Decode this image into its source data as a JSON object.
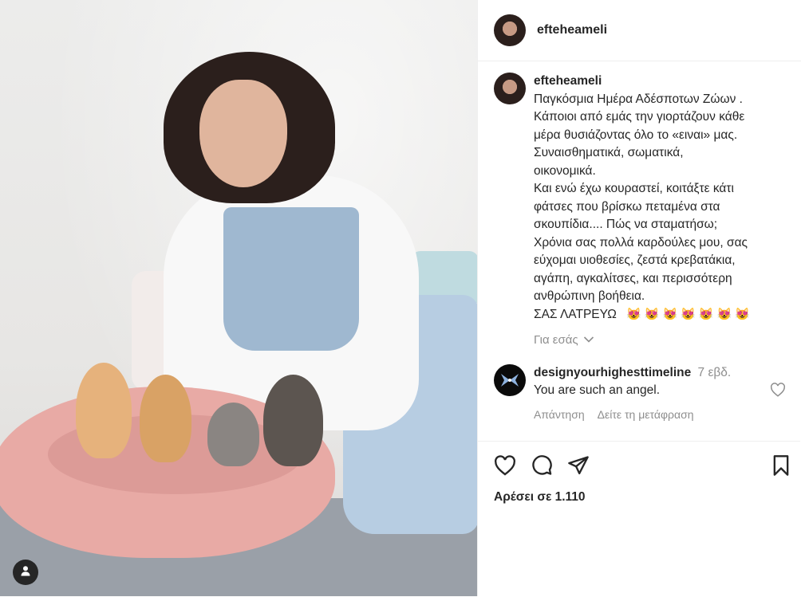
{
  "post": {
    "username": "efteheameli",
    "caption_lines": [
      "Παγκόσμια Ημέρα Αδέσποτων Ζώων .",
      "Κάποιοι από εμάς την γιορτάζουν κάθε",
      "μέρα θυσιάζοντας όλο το «ειναι» μας.",
      "Συναισθηματικά, σωματικά,",
      "οικονομικά.",
      "Και ενώ έχω κουραστεί, κοιτάξτε κάτι",
      "φάτσες που βρίσκω πεταμένα στα",
      "σκουπίδια.... Πώς να σταματήσω;",
      "Χρόνια σας πολλά καρδούλες μου, σας",
      "εύχομαι υιοθεσίες, ζεστά κρεβατάκια,",
      "αγάπη, αγκαλίτσες, και περισσότερη",
      "ανθρώπινη βοήθεια.",
      "ΣΑΣ ΛΑΤΡΕΥΩ"
    ],
    "emoji_count": 7,
    "see_translation": "Για εσάς",
    "likes_text": "Αρέσει σε 1.110"
  },
  "comments": [
    {
      "username": "designyourhighesttimeline",
      "time": "7 εβδ.",
      "text": "You are such an angel.",
      "reply_label": "Απάντηση",
      "translate_label": "Δείτε τη μετάφραση"
    }
  ],
  "icons": {
    "like": "heart-icon",
    "comment": "comment-icon",
    "share": "send-icon",
    "save": "bookmark-icon",
    "tagged": "person-icon"
  },
  "colors": {
    "text": "#262626",
    "muted": "#8e8e8e",
    "divider": "#efefef",
    "emoji": "#e6502b"
  }
}
